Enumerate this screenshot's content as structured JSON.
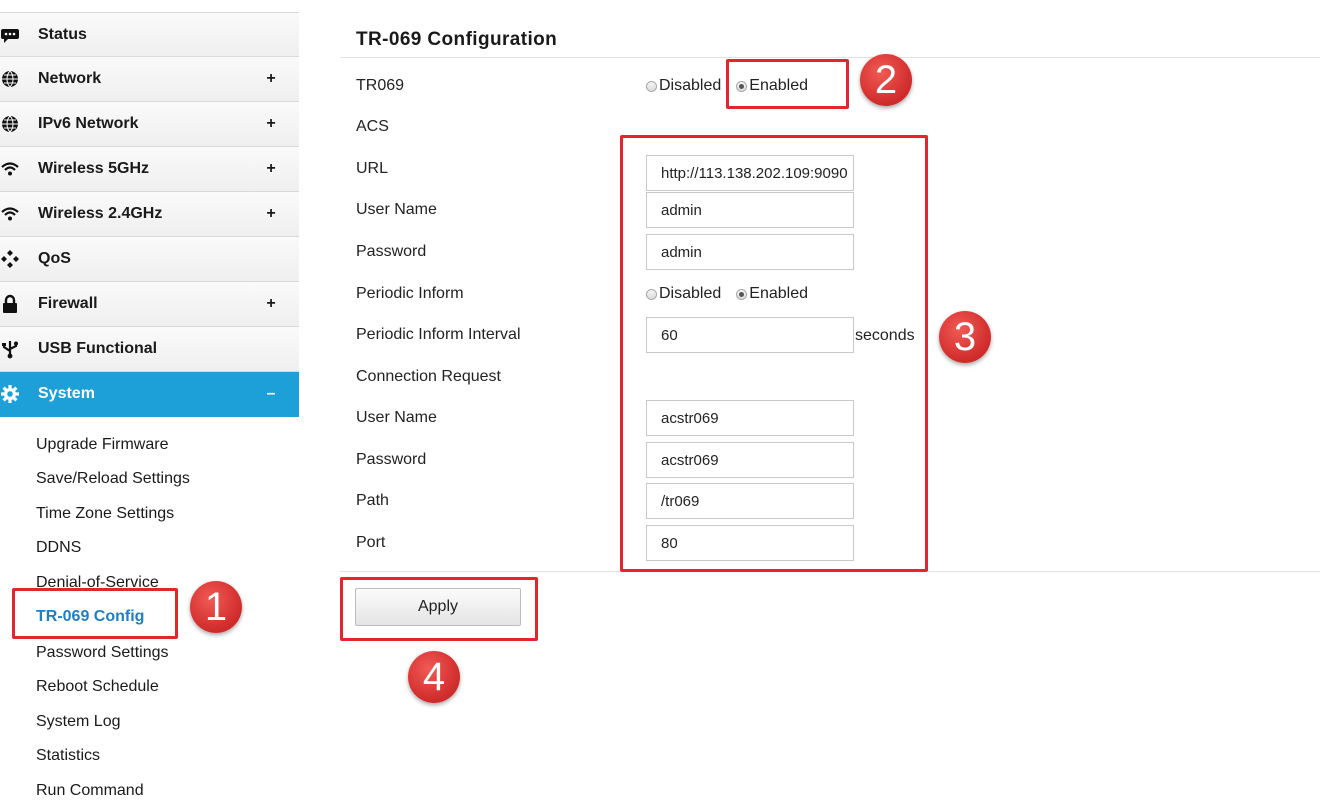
{
  "sidebar": {
    "items": [
      {
        "label": "Status",
        "icon": "chat-icon",
        "expander": ""
      },
      {
        "label": "Network",
        "icon": "globe-icon",
        "expander": "+"
      },
      {
        "label": "IPv6 Network",
        "icon": "globe-icon",
        "expander": "+"
      },
      {
        "label": "Wireless 5GHz",
        "icon": "wifi-icon",
        "expander": "+"
      },
      {
        "label": "Wireless 2.4GHz",
        "icon": "wifi-icon",
        "expander": "+"
      },
      {
        "label": "QoS",
        "icon": "qos-icon",
        "expander": ""
      },
      {
        "label": "Firewall",
        "icon": "lock-icon",
        "expander": "+"
      },
      {
        "label": "USB Functional",
        "icon": "usb-icon",
        "expander": ""
      },
      {
        "label": "System",
        "icon": "gear-icon",
        "expander": "–"
      }
    ],
    "subitems": [
      "Upgrade Firmware",
      "Save/Reload Settings",
      "Time Zone Settings",
      "DDNS",
      "Denial-of-Service",
      "TR-069 Config",
      "Password Settings",
      "Reboot Schedule",
      "System Log",
      "Statistics",
      "Run Command"
    ],
    "active_color": "#1d9fd8",
    "current_subitem_color": "#1d7fc6"
  },
  "main": {
    "title": "TR-069 Configuration",
    "tr069": {
      "label": "TR069",
      "options": [
        "Disabled",
        "Enabled"
      ],
      "selected": "Enabled"
    },
    "acs_header": "ACS",
    "url": {
      "label": "URL",
      "value": "http://113.138.202.109:9090"
    },
    "acs_user": {
      "label": "User Name",
      "value": "admin"
    },
    "acs_pass": {
      "label": "Password",
      "value": "admin"
    },
    "periodic_inform": {
      "label": "Periodic Inform",
      "options": [
        "Disabled",
        "Enabled"
      ],
      "selected": "Enabled"
    },
    "periodic_interval": {
      "label": "Periodic Inform Interval",
      "value": "60",
      "unit": "seconds"
    },
    "conn_header": "Connection Request",
    "conn_user": {
      "label": "User Name",
      "value": "acstr069"
    },
    "conn_pass": {
      "label": "Password",
      "value": "acstr069"
    },
    "path": {
      "label": "Path",
      "value": "/tr069"
    },
    "port": {
      "label": "Port",
      "value": "80"
    },
    "apply_label": "Apply"
  },
  "annotations": {
    "steps": [
      "1",
      "2",
      "3",
      "4"
    ],
    "color": "#e4262c"
  }
}
